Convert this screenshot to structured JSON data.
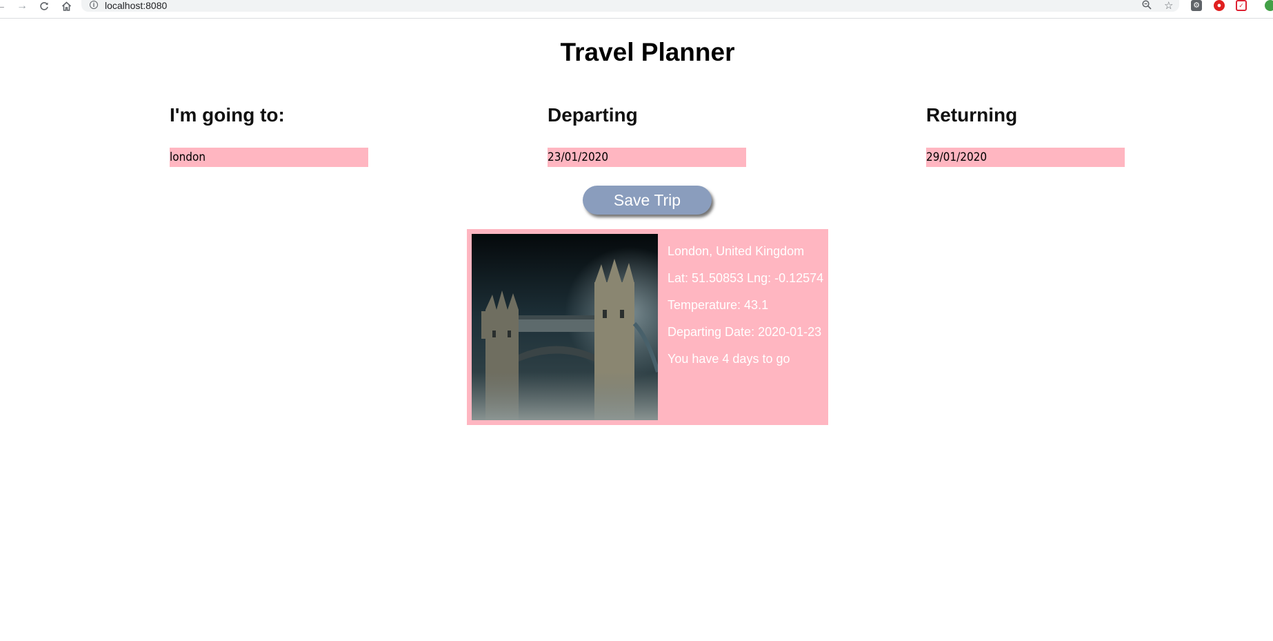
{
  "browser": {
    "url": "localhost:8080",
    "icons": [
      "back-icon",
      "forward-icon",
      "reload-icon",
      "home-icon",
      "info-icon",
      "zoom-icon",
      "star-icon"
    ]
  },
  "page": {
    "title": "Travel Planner",
    "destination": {
      "label": "I'm going to:",
      "value": "london"
    },
    "departing": {
      "label": "Departing",
      "value": "23/01/2020"
    },
    "returning": {
      "label": "Returning",
      "value": "29/01/2020"
    },
    "save_button": "Save Trip"
  },
  "result": {
    "location": "London, United Kingdom",
    "coords": "Lat: 51.50853 Lng: -0.12574",
    "temperature": "Temperature: 43.1",
    "departing_date": "Departing Date: 2020-01-23",
    "countdown": "You have 4 days to go"
  },
  "colors": {
    "input_bg": "#ffb6c1",
    "button_bg": "#8a9dbd",
    "card_bg": "#ffb6c1"
  }
}
